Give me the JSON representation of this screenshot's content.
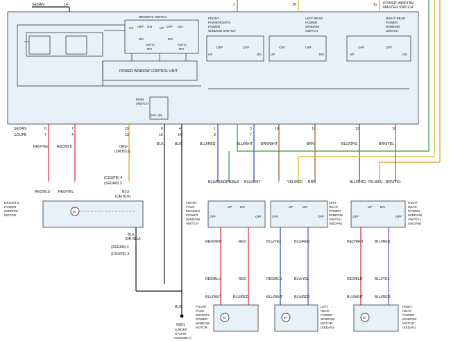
{
  "module": {
    "master_title": "POWER WINDOW MASTER SWITCH",
    "drivers_switch": "DRIVER'S SWITCH",
    "control_unit": "POWER WINDOW CONTROL UNIT",
    "main_switch": "MAIN SWITCH",
    "off_on": "OFF ON",
    "fp_switch": "FRONT PASSENGER'S POWER WINDOW SWITCH",
    "lr_switch": "LEFT REAR POWER WINDOW SWITCH",
    "rr_switch": "RIGHT REAR POWER WINDOW SWITCH"
  },
  "switch_labels": {
    "up": "UP",
    "dn": "DN",
    "off": "OFF",
    "auto": "AUTO",
    "on": "ON"
  },
  "top_pins": {
    "sedan": "SEDAN",
    "p14": "14",
    "p2": "2",
    "p18": "18",
    "p11": "11"
  },
  "pins": {
    "sedan": "SEDAN",
    "coupe": "COUPE",
    "p6": "6",
    "p7": "7",
    "p7b": "7",
    "p4": "4",
    "p20": "20",
    "p13": "13",
    "p8": "8",
    "p10": "10",
    "p4b": "4",
    "p14": "14",
    "p1": "1",
    "p3": "3",
    "p3b": "3",
    "p7c": "7",
    "p19": "19",
    "p17": "17",
    "p12": "12",
    "p10b": "10"
  },
  "wires": {
    "red_yel": "RED/YEL",
    "red_blk": "RED/BLK",
    "org": "ORG",
    "or_blu": "(OR BLU)",
    "blk": "BLK",
    "blk2": "BLK",
    "blu_red": "BLU/RED",
    "blu_wht": "BLU/WHT",
    "brn_wht": "BRN/WHT",
    "brn": "BRN",
    "blu_org": "BLU/ORG",
    "brn_yel": "BRN/YEL",
    "blu_red2": "BLU/RED",
    "grn_blk": "GRN/BLK",
    "blu_wht2": "BLU/WHT",
    "yel_red": "YEL/RED",
    "brn2": "BRN",
    "blu_org2": "BLU/ORG",
    "yel_blu": "YEL/BLU",
    "brn_yel2": "BRN/YEL",
    "red_blu": "RED/BLU",
    "red_yel2": "RED/YEL",
    "coupe4": "(COUPE) 4",
    "sedan3": "(SEDAN) 3",
    "blu_or": "BLU",
    "or_blk": "(OR BLK)",
    "blk3": "BLK",
    "or_blu2": "(OR BLU)",
    "sedan4": "(SEDAN) 4",
    "coupe3": "(COUPE) 3"
  },
  "driver_motor": "DRIVER'S POWER WINDOW MOTOR",
  "fp_switch2": "FRONT PASSENGER'S POWER WINDOW SWITCH",
  "lr_switch2": "LEFT REAR POWER WINDOW SWITCH (SEDAN)",
  "rr_switch2": "RIGHT REAR POWER WINDOW SWITCH (SEDAN)",
  "lower_wires": {
    "red_wht": "RED/WHT",
    "red": "RED",
    "blu_yel": "BLU/YEL",
    "blu_red": "BLU/RED",
    "red_wht2": "RED/WHT",
    "blu_red2": "BLU/RED",
    "red_blu": "RED/BLU",
    "red2": "RED",
    "red_blu2": "RED/BLU",
    "blu_yel2": "BLU/YEL",
    "red_blu3": "RED/BLU",
    "blu_yel3": "BLU/YEL",
    "blu_wht": "BLU/WHT",
    "blu_red3": "BLU/RED",
    "blu_wht2": "BLU/WHT",
    "blu_red4": "BLU/RED",
    "blu_wht3": "BLU/WHT",
    "blu_red5": "BLU/RED"
  },
  "motors": {
    "fp": "FRONT PASSENGER'S POWER WINDOW MOTOR",
    "lr": "LEFT REAR POWER WINDOW MOTOR (SEDAN)",
    "rr": "RIGHT REAR POWER WINDOW MOTOR (SEDAN)"
  },
  "ground": {
    "blk": "BLK",
    "id": "G501",
    "loc": "(UNDER GAUGE ASSEMBLY)"
  },
  "colors": {
    "panel": "#e6f1f8",
    "red": "#d8232a",
    "blue": "#2b3fb8",
    "violet": "#6b3fb8",
    "green": "#2e9a3c",
    "orange": "#e89a1c",
    "yellow": "#d9b81a",
    "black": "#111111"
  }
}
